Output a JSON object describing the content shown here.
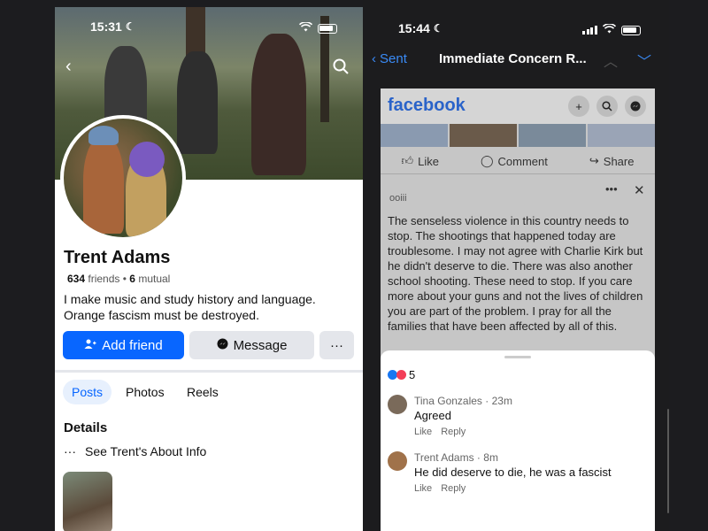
{
  "left_phone": {
    "status": {
      "time": "15:31"
    },
    "profile": {
      "name": "Trent Adams",
      "friends_count": "634",
      "friends_label": "friends",
      "mutual_count": "6",
      "mutual_label": "mutual",
      "bio": "I make music and study history and language. Orange fascism must be destroyed."
    },
    "buttons": {
      "add_friend": "Add friend",
      "message": "Message",
      "more": "···"
    },
    "tabs": [
      {
        "label": "Posts",
        "active": true
      },
      {
        "label": "Photos"
      },
      {
        "label": "Reels"
      }
    ],
    "details": {
      "title": "Details",
      "about_link": "See Trent's About Info",
      "about_icon": "···"
    }
  },
  "right_phone": {
    "status": {
      "time": "15:44"
    },
    "mail": {
      "back_label": "Sent",
      "subject": "Immediate Concern R..."
    },
    "facebook": {
      "logo": "facebook",
      "actions": {
        "like": "Like",
        "comment": "Comment",
        "share": "Share"
      },
      "post_meta": "ooiii",
      "post_text": "The senseless violence in this country needs to stop. The shootings that happened today are troublesome. I may not agree with Charlie Kirk but he didn't deserve to die. There was also another school shooting. These need to stop. If you care more about your guns and not the lives of children you are part of the problem. I pray for all the families that have been affected by all of this."
    },
    "comments_panel": {
      "reaction_count": "5",
      "comments": [
        {
          "author": "Tina Gonzales",
          "time": "23m",
          "text": "Agreed",
          "like": "Like",
          "reply": "Reply"
        },
        {
          "author": "Trent Adams",
          "time": "8m",
          "text": "He did deserve to die, he was a fascist",
          "like": "Like",
          "reply": "Reply"
        }
      ]
    }
  },
  "colors": {
    "fb_blue": "#0866ff",
    "ios_blue": "#3a8bf7",
    "love": "#f33e58",
    "like": "#1877f2"
  }
}
